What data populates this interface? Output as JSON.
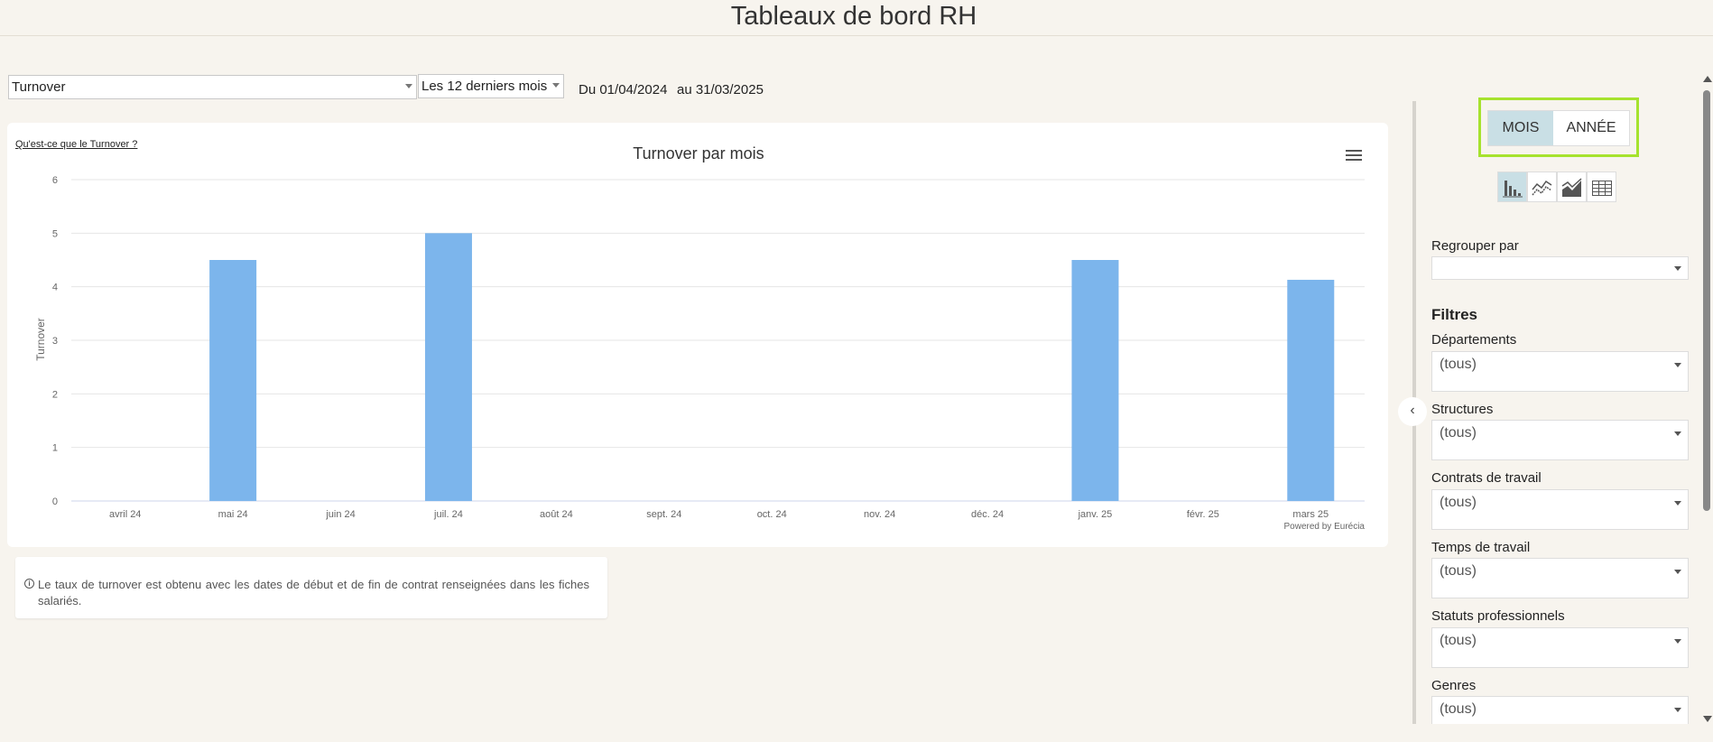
{
  "header": {
    "title": "Tableaux de bord RH"
  },
  "toolbar": {
    "indicator_value": "Turnover",
    "period_value": "Les 12 derniers mois",
    "date_from": "Du 01/04/2024",
    "date_to": "au 31/03/2025"
  },
  "chart_card": {
    "help_link": "Qu'est-ce que le Turnover ?",
    "credit": "Powered by Eurécia"
  },
  "chart_data": {
    "type": "bar",
    "title": "Turnover par mois",
    "xlabel": "",
    "ylabel": "Turnover",
    "categories": [
      "avril 24",
      "mai 24",
      "juin 24",
      "juil. 24",
      "août 24",
      "sept. 24",
      "oct. 24",
      "nov. 24",
      "déc. 24",
      "janv. 25",
      "févr. 25",
      "mars 25"
    ],
    "values": [
      0,
      4.5,
      0,
      5,
      0,
      0,
      0,
      0,
      0,
      4.5,
      0,
      4.13
    ],
    "ylim": [
      0,
      6
    ],
    "yticks": [
      "0",
      "1",
      "2",
      "3",
      "4",
      "5",
      "6"
    ],
    "grid": true,
    "bar_color": "#7cb5ec"
  },
  "info": {
    "text": "Le taux de turnover est obtenu avec les dates de début et de fin de contrat renseignées dans les fiches salariés."
  },
  "sidebar": {
    "toggle": {
      "mois": "MOIS",
      "annee": "ANNÉE"
    },
    "view_icons": [
      "bar-chart-icon",
      "line-chart-icon",
      "area-chart-icon",
      "table-icon"
    ],
    "group_by_label": "Regrouper par",
    "group_by_value": "",
    "filters_title": "Filtres",
    "filters": [
      {
        "label": "Départements",
        "value": "(tous)"
      },
      {
        "label": "Structures",
        "value": "(tous)"
      },
      {
        "label": "Contrats de travail",
        "value": "(tous)"
      },
      {
        "label": "Temps de travail",
        "value": "(tous)"
      },
      {
        "label": "Statuts professionnels",
        "value": "(tous)"
      },
      {
        "label": "Genres",
        "value": "(tous)"
      }
    ]
  },
  "colors": {
    "accent_outline": "#a6e22e",
    "active_toggle": "#c9dfe5",
    "page_bg": "#f7f4ee"
  }
}
